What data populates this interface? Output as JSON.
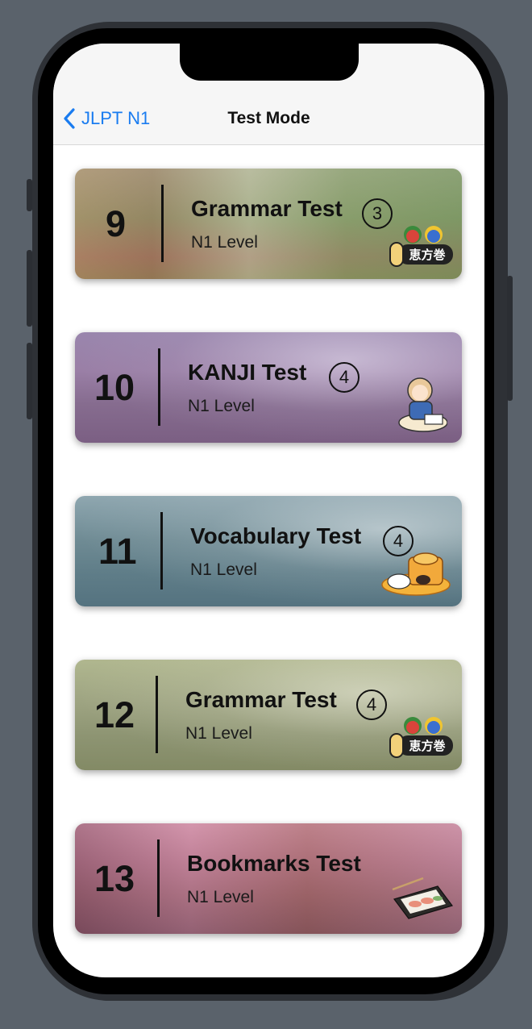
{
  "nav": {
    "back_label": "JLPT N1",
    "title": "Test Mode"
  },
  "cards": [
    {
      "number": "9",
      "title": "Grammar Test",
      "count": "3",
      "level": "N1 Level",
      "sticker": "ehomaki-icon",
      "sticker_text": "恵方巻"
    },
    {
      "number": "10",
      "title": "KANJI  Test",
      "count": "4",
      "level": "N1 Level",
      "sticker": "studying-girl-icon"
    },
    {
      "number": "11",
      "title": "Vocabulary Test",
      "count": "4",
      "level": "N1 Level",
      "sticker": "rabbit-mochi-icon"
    },
    {
      "number": "12",
      "title": "Grammar Test",
      "count": "4",
      "level": "N1 Level",
      "sticker": "ehomaki-icon",
      "sticker_text": "恵方巻"
    },
    {
      "number": "13",
      "title": "Bookmarks Test",
      "count": "",
      "level": "N1 Level",
      "sticker": "sushi-platter-icon"
    }
  ],
  "colors": {
    "accent": "#1a7cf0",
    "card_green": "#7f9968",
    "card_mauve": "#8a6f94",
    "card_teal": "#6d8d9a",
    "card_olive": "#9aa37d",
    "card_pink": "#b9708a"
  }
}
